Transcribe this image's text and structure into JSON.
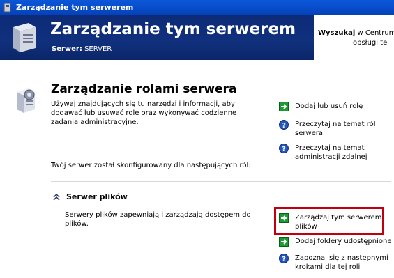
{
  "window": {
    "title": "Zarządzanie tym serwerem"
  },
  "header": {
    "title": "Zarządzanie tym serwerem",
    "server_label": "Serwer:",
    "server_name": "SERVER",
    "search_link": "Wyszukaj",
    "search_text_1": "w Centrum",
    "search_text_2": "obsługi te"
  },
  "roles_section": {
    "title": "Zarządzanie rolami serwera",
    "description": "Używaj znajdujących się tu narzędzi i informacji, aby dodawać lub usuwać role oraz wykonywać codzienne zadania administracyjne.",
    "configured_text": "Twój serwer został skonfigurowany dla następujących ról:",
    "actions": [
      {
        "label": "Dodaj lub usuń rolę",
        "icon": "green-arrow-icon"
      },
      {
        "label": "Przeczytaj na temat ról serwera",
        "icon": "help-icon"
      },
      {
        "label": "Przeczytaj na temat administracji zdalnej",
        "icon": "help-icon"
      }
    ]
  },
  "file_server_role": {
    "name": "Serwer plików",
    "description": "Serwery plików zapewniają i zarządzają dostępem do plików.",
    "actions": [
      {
        "label": "Zarządzaj tym serwerem plików",
        "icon": "green-arrow-icon"
      },
      {
        "label": "Dodaj foldery udostępnione",
        "icon": "green-arrow-icon"
      },
      {
        "label": "Zapoznaj się z następnymi krokami dla tej roli",
        "icon": "help-icon"
      }
    ]
  },
  "colors": {
    "header_bg": "#10307d",
    "titlebar": "#0a4fcf",
    "highlight": "#c0000f"
  }
}
